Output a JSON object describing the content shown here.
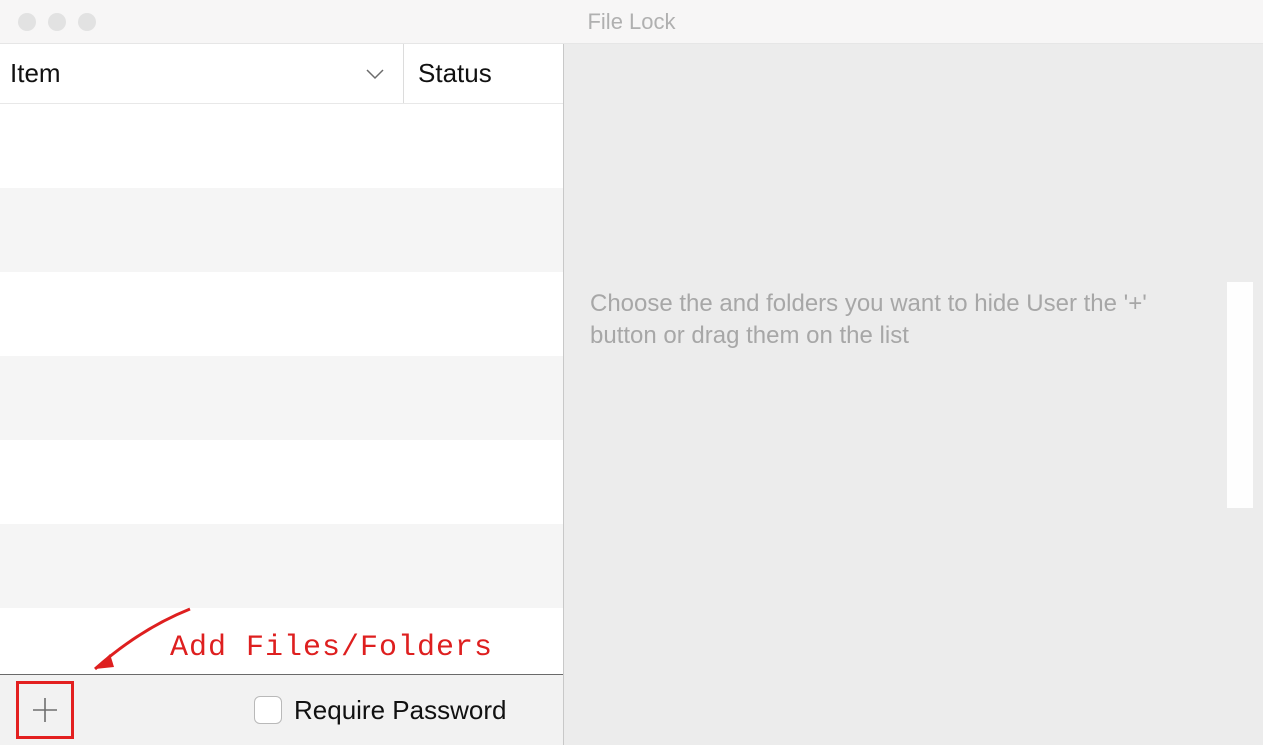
{
  "window": {
    "title": "File Lock"
  },
  "columns": {
    "item": "Item",
    "status": "Status"
  },
  "rows": [
    {
      "item": "",
      "status": ""
    },
    {
      "item": "",
      "status": ""
    },
    {
      "item": "",
      "status": ""
    },
    {
      "item": "",
      "status": ""
    },
    {
      "item": "",
      "status": ""
    },
    {
      "item": "",
      "status": ""
    },
    {
      "item": "",
      "status": ""
    }
  ],
  "bottom": {
    "require_password_label": "Require Password",
    "require_password_checked": false
  },
  "instructions": "Choose the and folders you want to hide User the '+' button or drag them on the list",
  "annotation": {
    "label": "Add Files/Folders"
  },
  "colors": {
    "annotation": "#de1f1f",
    "highlight_border": "#e32020"
  }
}
